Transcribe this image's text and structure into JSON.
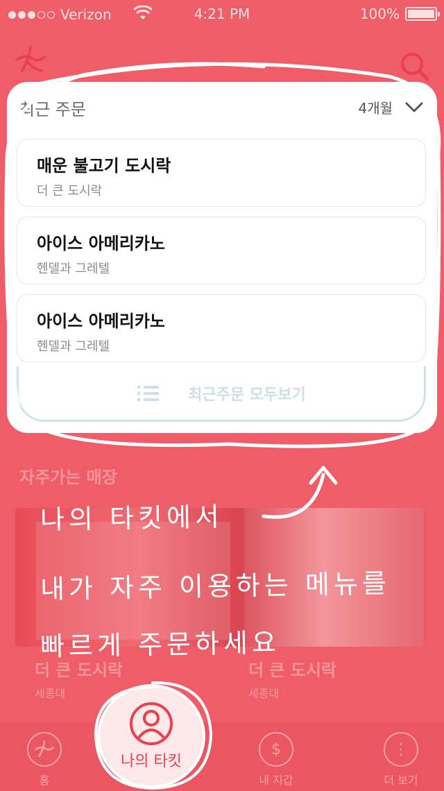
{
  "status_bar": {
    "carrier": "Verizon",
    "time": "4:21 PM",
    "battery": "100%"
  },
  "recent_orders": {
    "title": "최근 주문",
    "period": "4개월",
    "items": [
      {
        "name": "매운 불고기 도시락",
        "store": "더 큰 도시락"
      },
      {
        "name": "아이스 아메리카노",
        "store": "헨델과 그레텔"
      },
      {
        "name": "아이스 아메리카노",
        "store": "헨델과 그레텔"
      }
    ],
    "view_all_label": "최근주문 모두보기"
  },
  "frequent_stores": {
    "title": "자주가는 매장",
    "stores": [
      {
        "name": "더 큰 도시락",
        "location": "세종대"
      },
      {
        "name": "더 큰 도시락",
        "location": "세종대"
      }
    ]
  },
  "promo": {
    "line1": "나의 타킷에서",
    "line2": "내가 자주 이용하는 메뉴를",
    "line3": "빠르게 주문하세요"
  },
  "tab_bar": {
    "home": "홈",
    "my_ticket": "나의 타킷",
    "wallet": "내 지갑",
    "more": "더 보기"
  },
  "colors": {
    "background": "#ef5d68",
    "accent": "#e8404c",
    "card": "#ffffff"
  }
}
